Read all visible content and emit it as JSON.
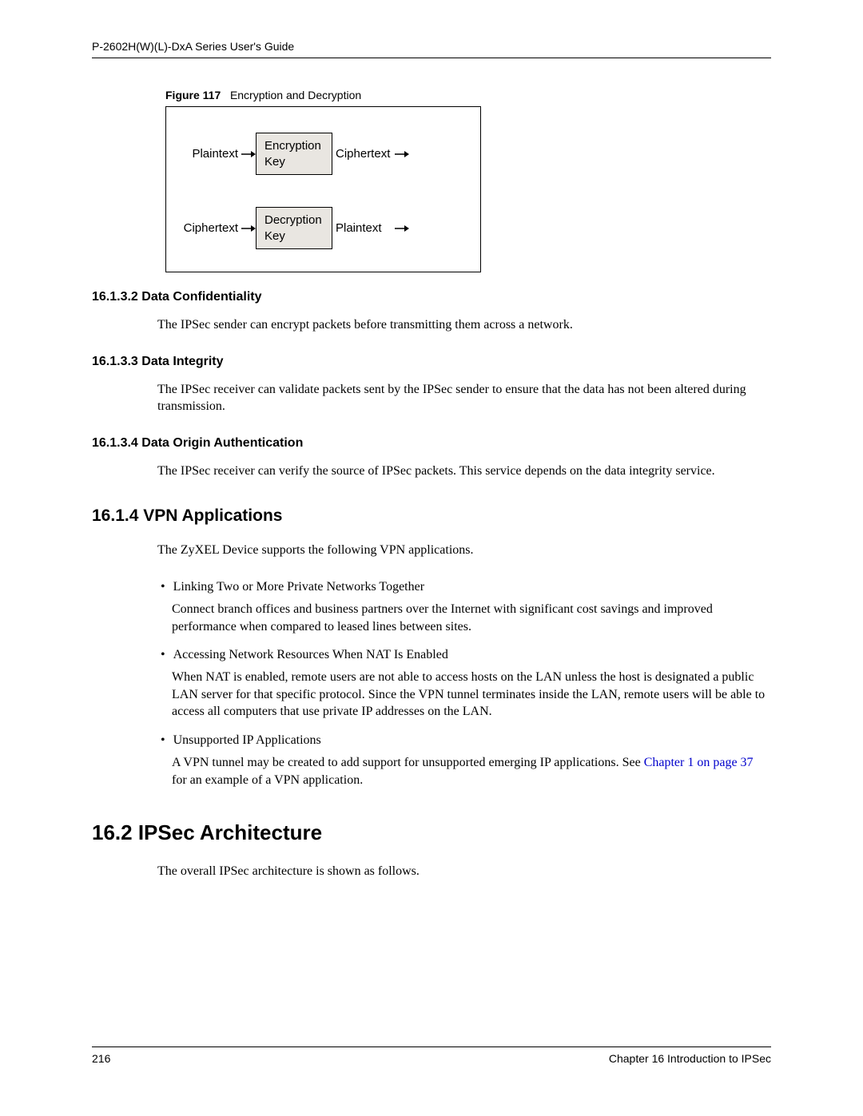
{
  "header": {
    "title": "P-2602H(W)(L)-DxA Series User's Guide"
  },
  "figure": {
    "caption_label": "Figure 117",
    "caption_text": "Encryption and Decryption",
    "row1": {
      "in": "Plaintext",
      "box": "Encryption Key",
      "out": "Ciphertext"
    },
    "row2": {
      "in": "Ciphertext",
      "box": "Decryption Key",
      "out": "Plaintext"
    }
  },
  "sections": {
    "s1": {
      "heading": "16.1.3.2  Data Confidentiality",
      "body": "The IPSec sender can encrypt packets before transmitting them across a network."
    },
    "s2": {
      "heading": "16.1.3.3  Data Integrity",
      "body": "The IPSec receiver can validate packets sent by the IPSec sender to ensure that the data has not been altered during transmission."
    },
    "s3": {
      "heading": "16.1.3.4  Data Origin Authentication",
      "body": "The IPSec receiver can verify the source of IPSec packets. This service depends on the data integrity service."
    },
    "s4": {
      "heading": "16.1.4  VPN Applications",
      "intro": "The ZyXEL Device supports the following VPN applications.",
      "b1": {
        "head": "Linking Two or More Private Networks Together",
        "desc": "Connect branch offices and business partners over the Internet with significant cost savings and improved performance when compared to leased lines between sites."
      },
      "b2": {
        "head": "Accessing Network Resources When NAT Is Enabled",
        "desc": "When NAT is enabled, remote users are not able to access hosts on the LAN unless the host is designated a public LAN server for that specific protocol. Since the VPN tunnel terminates inside the LAN, remote users will be able to access all computers that use private IP addresses on the LAN."
      },
      "b3": {
        "head": "Unsupported IP Applications",
        "desc_pre": "A VPN tunnel may be created to add support for unsupported emerging IP applications. See ",
        "link": "Chapter 1 on page 37",
        "desc_post": " for an example of a VPN application."
      }
    },
    "s5": {
      "heading": "16.2  IPSec Architecture",
      "body": "The overall IPSec architecture is shown as follows."
    }
  },
  "footer": {
    "page": "216",
    "chapter": "Chapter 16 Introduction to IPSec"
  }
}
